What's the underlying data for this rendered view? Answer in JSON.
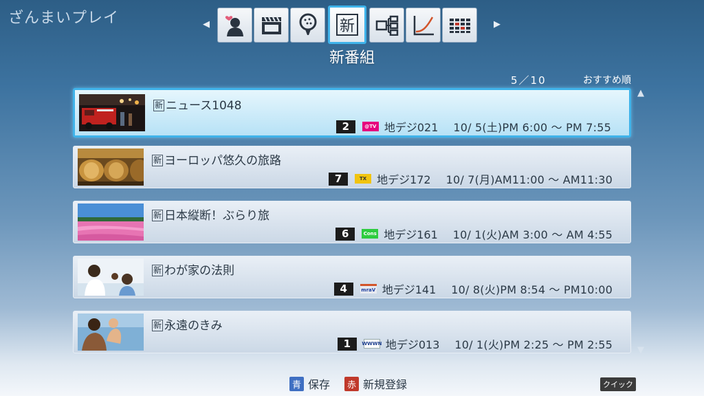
{
  "app": {
    "title": "ざんまいプレイ"
  },
  "nav": {
    "left_arrow": "◀",
    "right_arrow": "▶",
    "categories": [
      {
        "icon": "person-heart-icon",
        "selected": false
      },
      {
        "icon": "clapperboard-icon",
        "selected": false
      },
      {
        "icon": "golf-ball-icon",
        "selected": false
      },
      {
        "icon": "new-program-icon",
        "selected": true,
        "glyph": "新"
      },
      {
        "icon": "series-tree-icon",
        "selected": false
      },
      {
        "icon": "ranking-chart-icon",
        "selected": false
      },
      {
        "icon": "grid-icon",
        "selected": false
      }
    ]
  },
  "category_title": "新番組",
  "list_header": {
    "counter": "5／10",
    "sort": "おすすめ順"
  },
  "scroll": {
    "up": "▲",
    "down": "▼"
  },
  "programs": [
    {
      "badge": "新",
      "title": "ニュース1048",
      "channel": "2",
      "logo_text": "@TV",
      "logo_bg": "#e6007e",
      "logo_fg": "#ffffff",
      "station": "地デジ021",
      "airtime": "10/ 5(土)PM 6:00 ～ PM 7:55",
      "thumb": "fire-truck-thumbnail",
      "selected": true
    },
    {
      "badge": "新",
      "title": "ヨーロッパ悠久の旅路",
      "channel": "7",
      "logo_text": "TX",
      "logo_bg": "#f1c40f",
      "logo_fg": "#333333",
      "station": "地デジ172",
      "airtime": "10/ 7(月)AM11:00 ～ AM11:30",
      "thumb": "wine-barrels-thumbnail",
      "selected": false
    },
    {
      "badge": "新",
      "title": "日本縦断！ぶらり旅",
      "channel": "6",
      "logo_text": "Cons",
      "logo_bg": "#2ecc40",
      "logo_fg": "#ffffff",
      "station": "地デジ161",
      "airtime": "10/ 1(火)AM 3:00 ～ AM 4:55",
      "thumb": "flower-field-thumbnail",
      "selected": false
    },
    {
      "badge": "新",
      "title": "わが家の法則",
      "channel": "4",
      "logo_text": "mraV",
      "logo_bg": "#e8eaf0",
      "logo_fg": "#1d3fa0",
      "station": "地デジ141",
      "airtime": "10/ 8(火)PM 8:54 ～ PM10:00",
      "thumb": "family-thumbnail",
      "selected": false
    },
    {
      "badge": "新",
      "title": "永遠のきみ",
      "channel": "1",
      "logo_text": "WWWN",
      "logo_bg": "#ffffff",
      "logo_fg": "#1a3c8c",
      "station": "地デジ013",
      "airtime": "10/ 1(火)PM 2:25 ～ PM 2:55",
      "thumb": "mother-baby-thumbnail",
      "selected": false
    }
  ],
  "footer": {
    "blue_key": "青",
    "blue_label": "保存",
    "blue_color": "#3f6fc2",
    "red_key": "赤",
    "red_label": "新規登録",
    "red_color": "#c0392b",
    "quick": "クイック"
  }
}
